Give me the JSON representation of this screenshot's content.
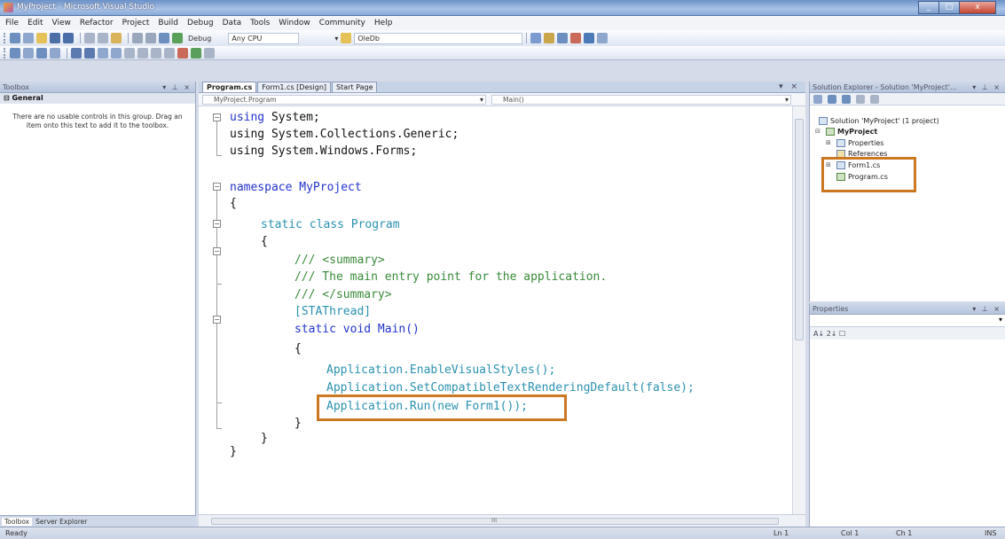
{
  "window": {
    "title": "MyProject - Microsoft Visual Studio",
    "controls": [
      "_",
      "□",
      "x"
    ]
  },
  "menu": [
    "File",
    "Edit",
    "View",
    "Refactor",
    "Project",
    "Build",
    "Debug",
    "Data",
    "Tools",
    "Window",
    "Community",
    "Help"
  ],
  "toolbar": {
    "config": "Debug",
    "platform": "Any CPU",
    "find": "OleDb"
  },
  "toolbox": {
    "title": "Toolbox",
    "header_ctrls": "▾ ⊥ ×",
    "group": "⊟ General",
    "empty_msg": "There are no usable controls in this group. Drag an item onto this text to add it to the toolbox.",
    "tabs": [
      "Toolbox",
      "Server Explorer"
    ]
  },
  "editor": {
    "tabs": [
      "Program.cs",
      "Form1.cs [Design]",
      "Start Page"
    ],
    "tab_ctrl": "▾ ×",
    "nav_left": "MyProject.Program",
    "nav_right": "Main()",
    "code": [
      "using System;",
      "using System.Collections.Generic;",
      "using System.Windows.Forms;",
      "namespace MyProject",
      "{",
      "static class Program",
      "{",
      "/// <summary>",
      "/// The main entry point for the application.",
      "/// </summary>",
      "[STAThread]",
      "static void Main()",
      "{",
      "Application.EnableVisualStyles();",
      "Application.SetCompatibleTextRenderingDefault(false);",
      "Application.Run(new Form1());",
      "}",
      "}",
      "}"
    ],
    "hscroll_marker": "III"
  },
  "solution_explorer": {
    "title": "Solution Explorer - Solution 'MyProject'...",
    "header_ctrls": "▾ ⊥ ×",
    "items": [
      "Solution 'MyProject' (1 project)",
      "MyProject",
      "Properties",
      "References",
      "Form1.cs",
      "Program.cs"
    ]
  },
  "properties": {
    "title": "Properties",
    "header_ctrls": "▾ ⊥ ×",
    "toolbar": "A↓ 2↓ ☐"
  },
  "status": {
    "text": "Ready",
    "ln": "Ln 1",
    "col": "Col 1",
    "ch": "Ch 1",
    "mode": "INS"
  },
  "colors": {
    "highlight": "#cc7722",
    "keyword": "#2233cc",
    "comment": "#3a8a3a",
    "type": "#2b91af"
  }
}
